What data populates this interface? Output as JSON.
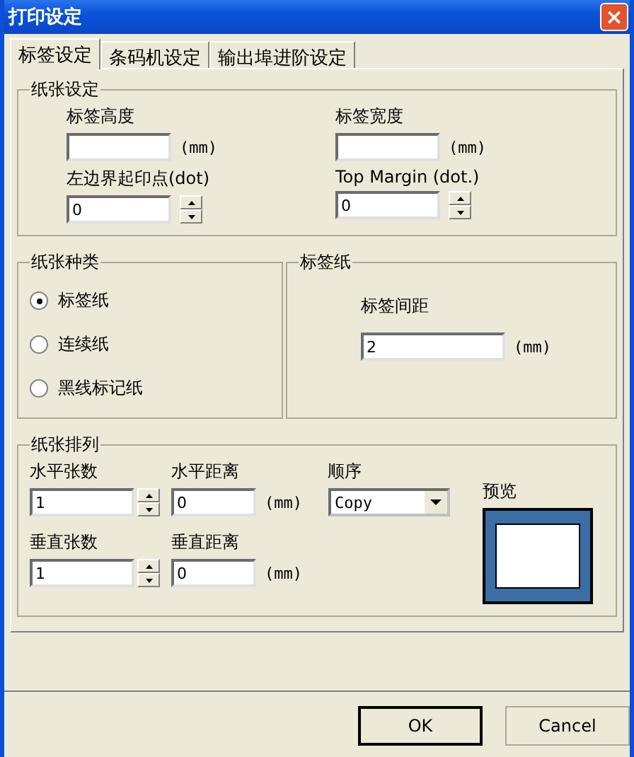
{
  "window": {
    "title": "打印设定",
    "close": "×"
  },
  "tabs": [
    {
      "label": "标签设定",
      "selected": true
    },
    {
      "label": "条码机设定",
      "selected": false
    },
    {
      "label": "输出埠进阶设定",
      "selected": false
    }
  ],
  "paper_settings": {
    "title": "纸张设定",
    "fields": [
      {
        "label": "标签高度",
        "unit": "(mm)",
        "kind": "text"
      },
      {
        "label": "标签宽度",
        "unit": "(mm)",
        "kind": "text"
      },
      {
        "label": "左边界起印点(dot)",
        "value": "0",
        "kind": "spin"
      },
      {
        "label": "Top Margin (dot.)",
        "value": "0",
        "kind": "spin"
      }
    ]
  },
  "paper_type": {
    "title": "纸张种类",
    "options": [
      {
        "label": "标签纸",
        "selected": true
      },
      {
        "label": "连续纸",
        "selected": false
      },
      {
        "label": "黑线标记纸",
        "selected": false
      }
    ]
  },
  "label_paper": {
    "title": "标签纸",
    "label": "标签间距",
    "value": "2",
    "unit": "(mm)"
  },
  "arrangement": {
    "title": "纸张排列",
    "rows": [
      {
        "count_label": "水平张数",
        "count": "1",
        "distance_label": "水平距离",
        "distance": "0",
        "unit": "(mm)"
      },
      {
        "count_label": "垂直张数",
        "count": "1",
        "distance_label": "垂直距离",
        "distance": "0",
        "unit": "(mm)"
      }
    ],
    "order_label": "顺序",
    "order": "Copy",
    "preview_label": "预览"
  },
  "buttons": [
    {
      "label": "OK",
      "default": true
    },
    {
      "label": "Cancel",
      "default": false
    }
  ]
}
